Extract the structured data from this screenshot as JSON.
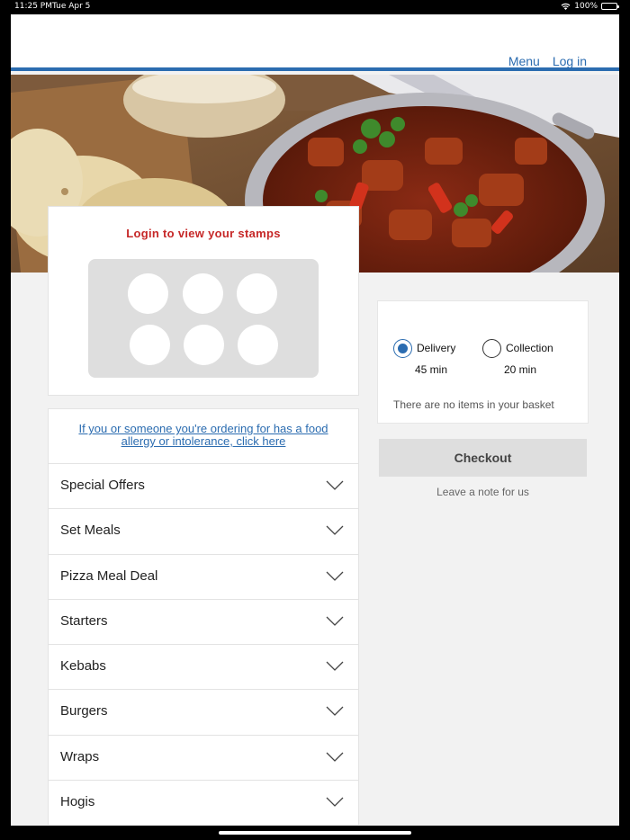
{
  "status_bar": {
    "time": "11:25 PM",
    "date": "Tue Apr 5",
    "battery": "100%"
  },
  "header": {
    "nav": {
      "menu": "Menu",
      "login": "Log in"
    }
  },
  "stamp_card": {
    "title": "Login to view your stamps",
    "stamps": 6
  },
  "allergy": {
    "link": "If you or someone you're ordering for has a food allergy or intolerance, click here"
  },
  "menu_categories": [
    "Special Offers",
    "Set Meals",
    "Pizza Meal Deal",
    "Starters",
    "Kebabs",
    "Burgers",
    "Wraps",
    "Hogis"
  ],
  "basket": {
    "delivery": {
      "label": "Delivery",
      "time": "45 min",
      "selected": true
    },
    "collection": {
      "label": "Collection",
      "time": "20 min",
      "selected": false
    },
    "empty_text": "There are no items in your basket"
  },
  "checkout": {
    "label": "Checkout",
    "note": "Leave a note for us"
  },
  "colors": {
    "accent": "#2b6cb0",
    "stamp_title": "#c62828"
  }
}
